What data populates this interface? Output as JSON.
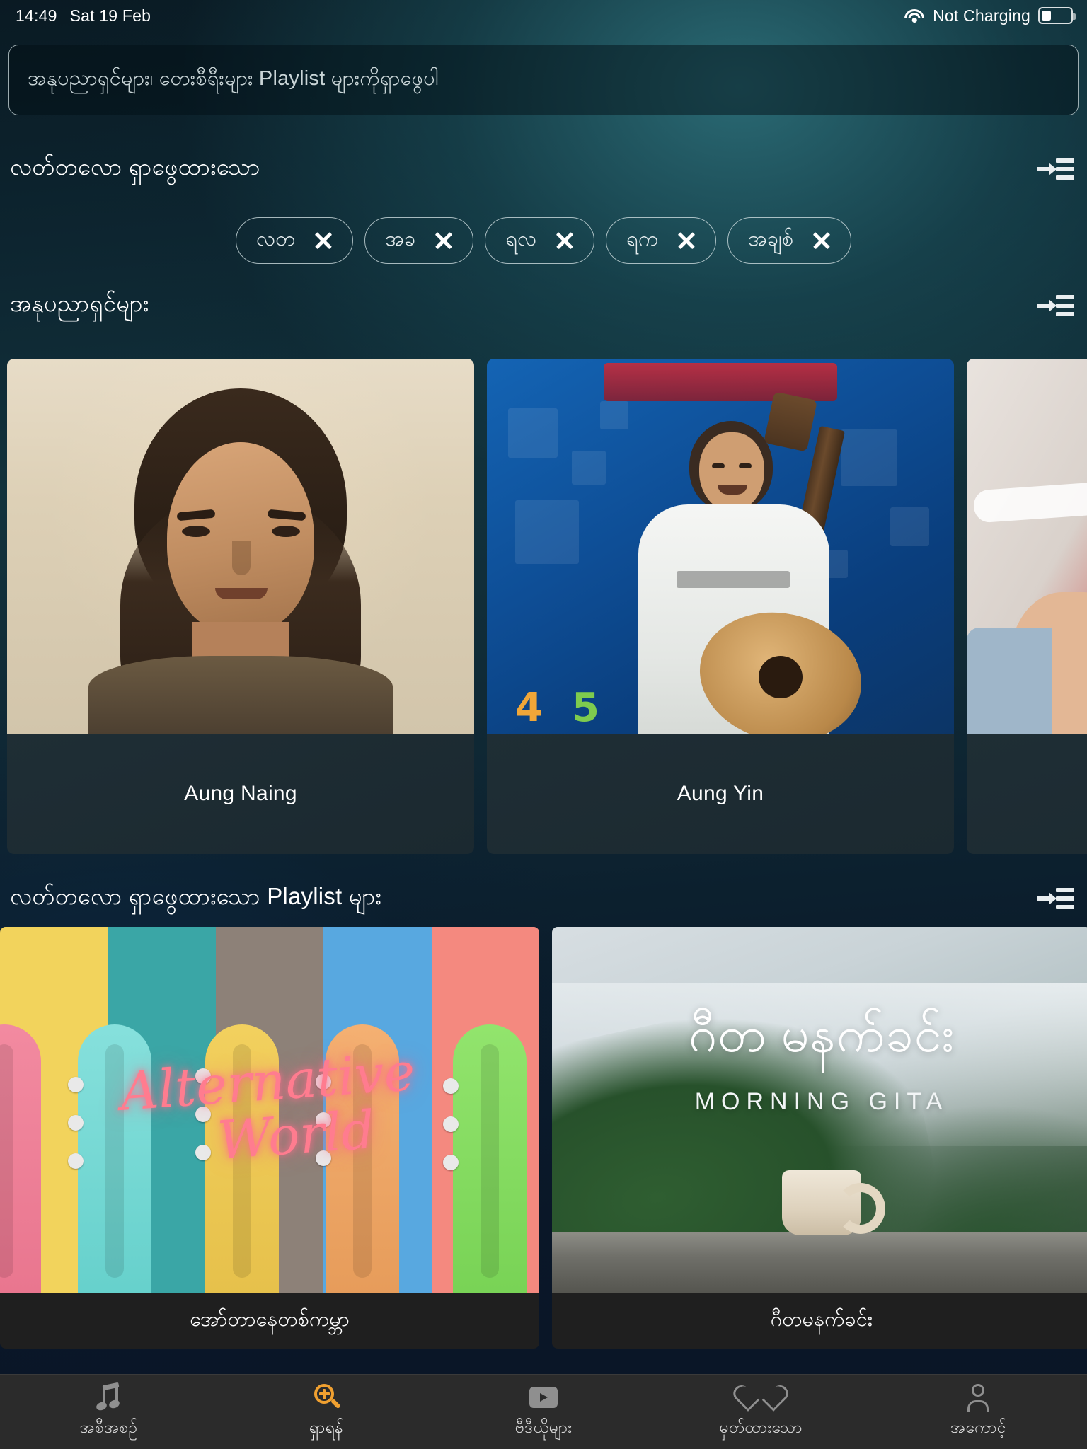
{
  "status_bar": {
    "time": "14:49",
    "date": "Sat 19 Feb",
    "battery_text": "Not Charging",
    "wifi_icon": "wifi-icon",
    "battery_icon": "battery-icon"
  },
  "search": {
    "placeholder": "အနုပညာရှင်များ၊ တေးစီရီးများ Playlist များကိုရှာဖွေပါ",
    "value": ""
  },
  "sections": {
    "recent_searches": {
      "title": "လတ်တလော ရှာဖွေထားသော",
      "see_all_icon": "see-all-icon"
    },
    "artists": {
      "title": "အနုပညာရှင်များ",
      "see_all_icon": "see-all-icon"
    },
    "recent_playlists": {
      "title": "လတ်တလော ရှာဖွေထားသော Playlist များ",
      "see_all_icon": "see-all-icon"
    }
  },
  "recent_chips": [
    {
      "label": "လတ",
      "remove_icon": "close-icon"
    },
    {
      "label": "အခ",
      "remove_icon": "close-icon"
    },
    {
      "label": "ရလ",
      "remove_icon": "close-icon"
    },
    {
      "label": "ရက",
      "remove_icon": "close-icon"
    },
    {
      "label": "အချစ်",
      "remove_icon": "close-icon"
    }
  ],
  "artists": [
    {
      "name": "Aung Naing"
    },
    {
      "name": "Aung Yin"
    },
    {
      "name": ""
    }
  ],
  "playlists": [
    {
      "name": "အော်တာနေတစ်ကမ္ဘာ",
      "art_text_line1": "Alternative",
      "art_text_line2": "World"
    },
    {
      "name": "ဂီတမနက်ခင်း",
      "art_title": "ဂီတ မနက်ခင်း",
      "art_subtitle": "MORNING GITA"
    }
  ],
  "tabs": [
    {
      "label": "အစီအစဉ်",
      "icon": "music-note-icon",
      "active": false
    },
    {
      "label": "ရှာရန်",
      "icon": "search-plus-icon",
      "active": true
    },
    {
      "label": "ဗီဒီယိုများ",
      "icon": "video-icon",
      "active": false
    },
    {
      "label": "မှတ်ထားသော",
      "icon": "heart-icon",
      "active": false
    },
    {
      "label": "အကောင့်",
      "icon": "person-icon",
      "active": false
    }
  ],
  "colors": {
    "accent": "#f0a030",
    "tabbar_bg": "#2b2b2b",
    "text_primary": "#ffffff"
  }
}
